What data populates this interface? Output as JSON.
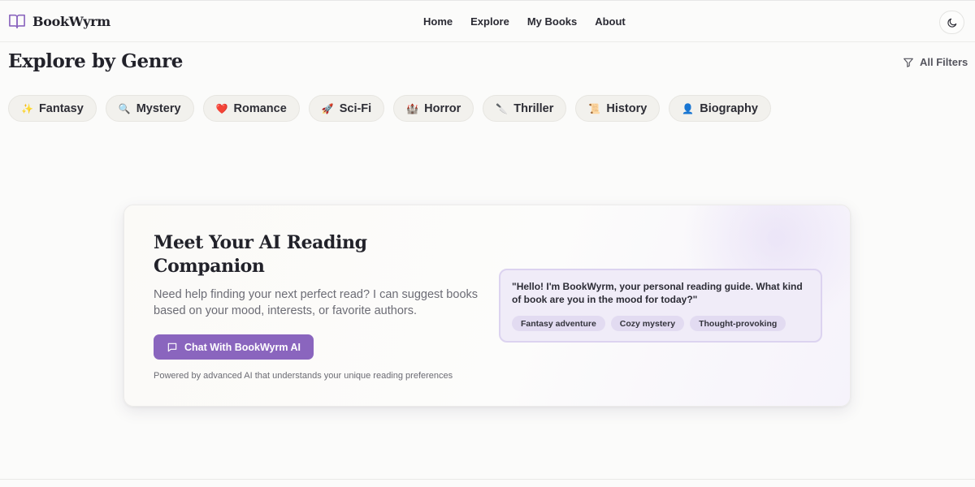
{
  "header": {
    "brand": "BookWyrm",
    "nav": [
      "Home",
      "Explore",
      "My Books",
      "About"
    ],
    "theme_toggle_icon": "moon-icon"
  },
  "page": {
    "title": "Explore by Genre",
    "filters_label": "All Filters",
    "filters_icon": "filter-icon"
  },
  "genres": [
    {
      "emoji": "✨",
      "label": "Fantasy"
    },
    {
      "emoji": "🔍",
      "label": "Mystery"
    },
    {
      "emoji": "❤️",
      "label": "Romance"
    },
    {
      "emoji": "🚀",
      "label": "Sci-Fi"
    },
    {
      "emoji": "🏰",
      "label": "Horror"
    },
    {
      "emoji": "🔪",
      "label": "Thriller"
    },
    {
      "emoji": "📜",
      "label": "History"
    },
    {
      "emoji": "👤",
      "label": "Biography"
    }
  ],
  "ai_card": {
    "title": "Meet Your AI Reading Companion",
    "description": "Need help finding your next perfect read? I can suggest books based on your mood, interests, or favorite authors.",
    "button_label": "Chat With BookWyrm AI",
    "button_icon": "chat-icon",
    "footnote": "Powered by advanced AI that understands your unique reading preferences",
    "bubble_text": "\"Hello! I'm BookWyrm, your personal reading guide. What kind of book are you in the mood for today?\"",
    "suggestions": [
      "Fantasy adventure",
      "Cozy mystery",
      "Thought-provoking"
    ]
  },
  "colors": {
    "accent": "#8a65be",
    "bubble_bg": "#f0ecf8",
    "chip_bg": "#f2f1ed"
  }
}
